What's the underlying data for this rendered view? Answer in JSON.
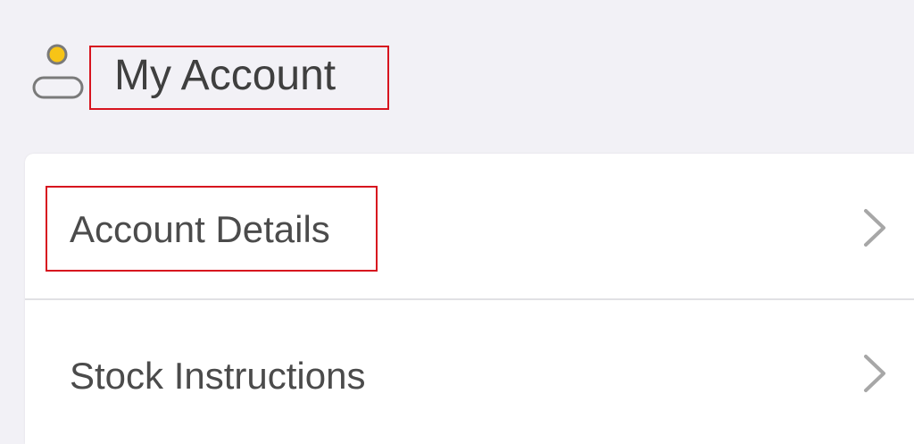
{
  "header": {
    "title": "My Account",
    "icon": "user-account-icon",
    "icon_colors": {
      "head": "#f7c416",
      "outline": "#7a7a7a"
    }
  },
  "menu": {
    "items": [
      {
        "label": "Account Details",
        "icon": "chevron-right-icon"
      },
      {
        "label": "Stock Instructions",
        "icon": "chevron-right-icon"
      }
    ]
  },
  "colors": {
    "background": "#f2f1f6",
    "card": "#ffffff",
    "highlight_border": "#d7141f",
    "text": "#4a4a4a",
    "chevron": "#a7a7a7"
  }
}
